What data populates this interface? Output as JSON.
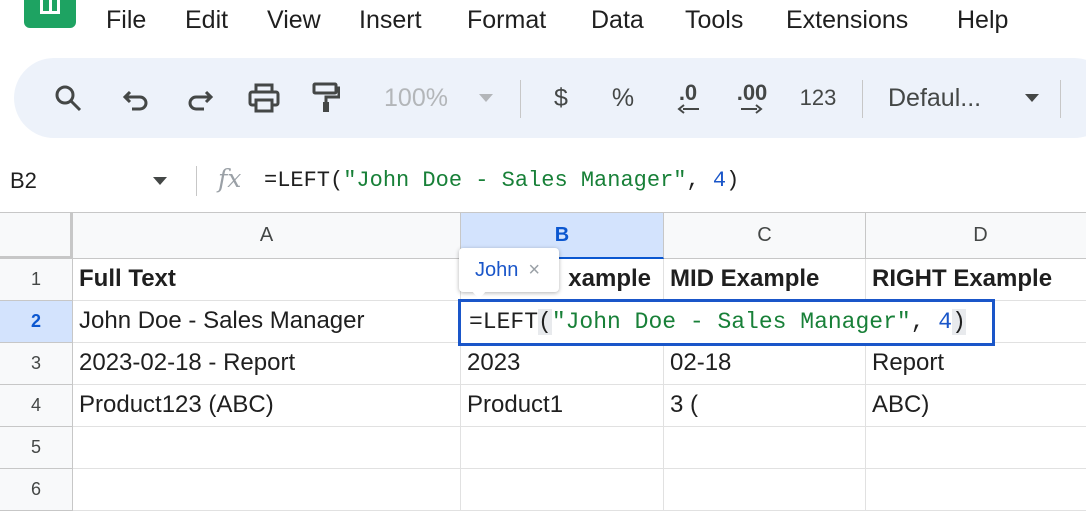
{
  "menu": {
    "items": [
      "File",
      "Edit",
      "View",
      "Insert",
      "Format",
      "Data",
      "Tools",
      "Extensions",
      "Help"
    ]
  },
  "toolbar": {
    "zoom": "100%",
    "currency": "$",
    "percent": "%",
    "decrease_decimal": ".0",
    "increase_decimal": ".00",
    "number_format": "123",
    "font": "Defaul..."
  },
  "formula_bar": {
    "name_box": "B2",
    "fx_label": "fx",
    "formula": {
      "func": "=LEFT(",
      "str": "\"John Doe - Sales Manager\"",
      "sep": ", ",
      "num": "4",
      "close": ")"
    }
  },
  "columns": [
    "A",
    "B",
    "C",
    "D"
  ],
  "rows": [
    "1",
    "2",
    "3",
    "4",
    "5",
    "6"
  ],
  "cells": {
    "r1": [
      "Full Text",
      "xample",
      "MID Example",
      "RIGHT Example"
    ],
    "r2": [
      "John Doe - Sales Manager",
      "",
      "",
      ""
    ],
    "r3": [
      "2023-02-18 - Report",
      "2023",
      "02-18",
      "Report"
    ],
    "r4": [
      "Product123 (ABC)",
      "Product1",
      "3 (",
      "ABC)"
    ]
  },
  "editor": {
    "func": "=LEFT",
    "open": "(",
    "str": "\"John Doe - Sales Manager\"",
    "sep": ", ",
    "num": "4",
    "close": ")"
  },
  "tooltip": {
    "preview": "John",
    "close_glyph": "×"
  },
  "colors": {
    "accent": "#0b57d0",
    "string": "#188038",
    "number": "#1a56c9",
    "header_bg": "#f8f9fa",
    "toolbar_bg": "#edf2fa",
    "logo": "#1ea362"
  }
}
